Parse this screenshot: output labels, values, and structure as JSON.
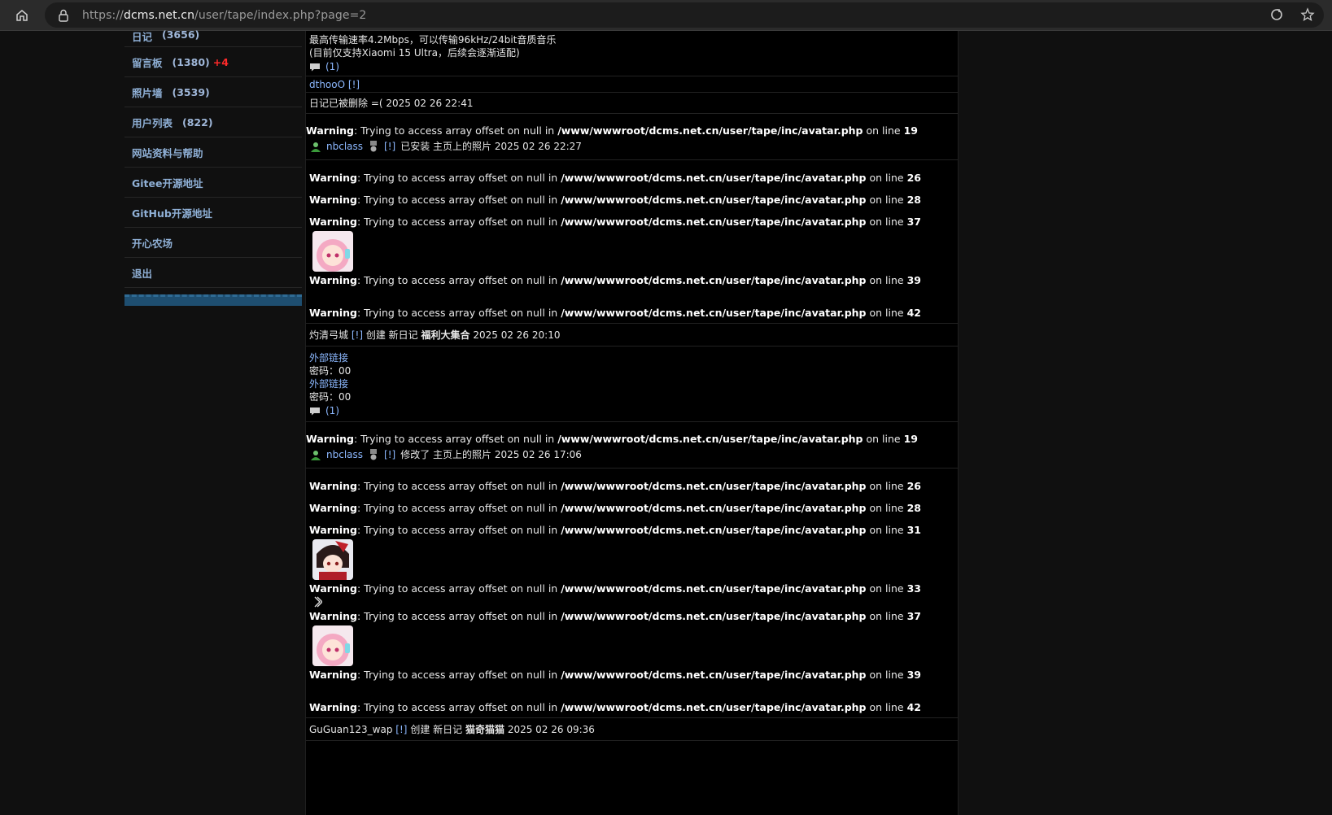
{
  "browser": {
    "url_prefix": "https://",
    "url_host": "dcms.net.cn",
    "url_path": "/user/tape/index.php?page=2"
  },
  "sidebar": {
    "items": [
      {
        "label": "日记",
        "count": "(3656)"
      },
      {
        "label": "留言板",
        "count": "(1380)",
        "badge": "+4"
      },
      {
        "label": "照片墙",
        "count": "(3539)"
      },
      {
        "label": "用户列表",
        "count": "(822)"
      },
      {
        "label": "网站资料与帮助"
      },
      {
        "label": "Gitee开源地址"
      },
      {
        "label": "GitHub开源地址"
      },
      {
        "label": "开心农场"
      },
      {
        "label": "退出"
      }
    ]
  },
  "feed": {
    "post1_line1": "最高传输速率4.2Mbps，可以传输96kHz/24bit音质音乐",
    "post1_line2": "(目前仅支持Xiaomi 15 Ultra，后续会逐渐适配)",
    "post1_comments": "(1)",
    "dthoo_user": "dthooO",
    "flag": "[!]",
    "deleted_text": "日记已被删除 =(",
    "deleted_time": "2025 02 26 22:41",
    "warning_label": "Warning",
    "warning_msg": ": Trying to access array offset on null in ",
    "warning_path": "/www/wwwroot/dcms.net.cn/user/tape/inc/avatar.php",
    "on_line": " on line ",
    "nb_user": "nbclass",
    "nb1_action": "已安装 主页上的照片 2025 02 26 22:27",
    "nb2_action": "修改了 主页上的照片 2025 02 26 17:06",
    "lines": {
      "l19": "19",
      "l26": "26",
      "l28": "28",
      "l31": "31",
      "l33": "33",
      "l37": "37",
      "l39": "39",
      "l42": "42"
    },
    "zhuo_user": "灼清弓城",
    "zhuo_action": "创建 新日记",
    "zhuo_title": "福利大集合",
    "zhuo_time": "2025 02 26 20:10",
    "ext_link": "外部链接",
    "password": "密码：00",
    "zhuo_comments": "(1)",
    "gu_user": "GuGuan123_wap",
    "gu_action": "创建 新日记",
    "gu_title": "猫奇猫猫",
    "gu_time": "2025 02 26 09:36"
  }
}
